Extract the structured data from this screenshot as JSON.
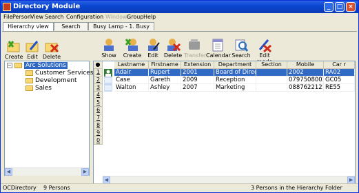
{
  "window": {
    "title": "Directory Module",
    "controls": [
      "_",
      "□",
      "×"
    ]
  },
  "menu": [
    "File",
    "Person",
    "View",
    "Search",
    "Configuration",
    "Windows",
    "Group",
    "Help"
  ],
  "view_tabs": [
    "Hierarchy view",
    "Search view",
    "Busy Lamp - 1. Busy Lamp"
  ],
  "tree_toolbar": [
    "Create",
    "Edit",
    "Delete"
  ],
  "grid_toolbar": [
    "Show",
    "Create",
    "Edit",
    "Delete",
    "Transfer",
    "Calendar",
    "Search",
    "Edit mode"
  ],
  "tree": {
    "root": "Arc Solutions",
    "children": [
      "Customer Services",
      "Development",
      "Sales"
    ]
  },
  "grid": {
    "columns": [
      "Lastname",
      "Firstname",
      "Extension",
      "Department",
      "Section",
      "Mobile",
      "Car r"
    ],
    "rows": [
      [
        "Adair",
        "Rupert",
        "2001",
        "Board of Directors",
        "",
        "2002",
        "RA02"
      ],
      [
        "Case",
        "Gareth",
        "2009",
        "Reception",
        "",
        "07975080034",
        "GC05"
      ],
      [
        "Walton",
        "Ashley",
        "2007",
        "Marketing",
        "",
        "08876221215",
        "RE55"
      ]
    ],
    "row_numbers": [
      "1",
      "2",
      "3",
      "4",
      "5",
      "6",
      "7",
      "8",
      "9",
      "0"
    ],
    "selected_row": 0
  },
  "status": {
    "app": "OCDirectory",
    "count": "9 Persons",
    "right": "3 Persons in the Hierarchy Folder"
  },
  "colors": {
    "titlebar": "#0a46d1",
    "selection": "#316ac5",
    "folder": "#f8d775"
  }
}
